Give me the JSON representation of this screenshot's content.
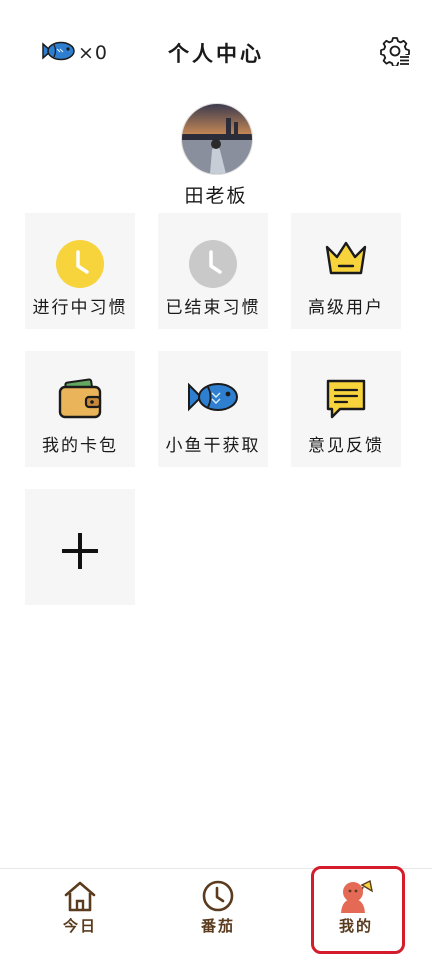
{
  "header": {
    "fish_count": "×0",
    "title": "个人中心",
    "fish_icon": "fish-icon",
    "settings_icon": "gear-list-icon"
  },
  "profile": {
    "name": "田老板",
    "avatar": "avatar-photo"
  },
  "tiles": [
    {
      "label": "进行中习惯",
      "icon": "clock-yellow-icon"
    },
    {
      "label": "已结束习惯",
      "icon": "clock-gray-icon"
    },
    {
      "label": "高级用户",
      "icon": "crown-icon"
    },
    {
      "label": "我的卡包",
      "icon": "wallet-icon"
    },
    {
      "label": "小鱼干获取",
      "icon": "fish-icon"
    },
    {
      "label": "意见反馈",
      "icon": "feedback-icon"
    },
    {
      "label": "",
      "icon": "plus-icon"
    }
  ],
  "nav": {
    "items": [
      {
        "label": "今日",
        "icon": "home-icon"
      },
      {
        "label": "番茄",
        "icon": "clock-icon"
      },
      {
        "label": "我的",
        "icon": "profile-mascot-icon"
      }
    ],
    "selected": "我的"
  },
  "colors": {
    "accent_yellow": "#F7D33C",
    "gray_clock": "#C9C9C9",
    "nav_brown": "#5A3B1E",
    "fish_blue": "#2F7FD0",
    "highlight_red": "#D41C2A",
    "mascot_red": "#E46A55"
  }
}
